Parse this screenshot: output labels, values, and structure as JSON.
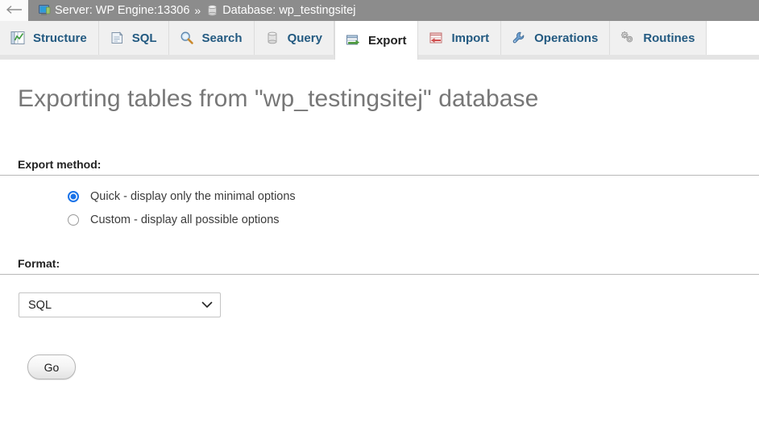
{
  "breadcrumb": {
    "back_label": "back-arrow",
    "separator": "»",
    "items": [
      {
        "icon": "server-monitor-icon",
        "label": "Server: WP Engine:13306"
      },
      {
        "icon": "database-cylinder-icon",
        "label": "Database: wp_testingsitej"
      }
    ]
  },
  "tabs": [
    {
      "id": "structure",
      "label": "Structure",
      "icon": "structure-icon",
      "active": false
    },
    {
      "id": "sql",
      "label": "SQL",
      "icon": "sql-icon",
      "active": false
    },
    {
      "id": "search",
      "label": "Search",
      "icon": "search-icon",
      "active": false
    },
    {
      "id": "query",
      "label": "Query",
      "icon": "query-icon",
      "active": false
    },
    {
      "id": "export",
      "label": "Export",
      "icon": "export-icon",
      "active": true
    },
    {
      "id": "import",
      "label": "Import",
      "icon": "import-icon",
      "active": false
    },
    {
      "id": "operations",
      "label": "Operations",
      "icon": "wrench-icon",
      "active": false
    },
    {
      "id": "routines",
      "label": "Routines",
      "icon": "gears-icon",
      "active": false
    }
  ],
  "main": {
    "page_title": "Exporting tables from \"wp_testingsitej\" database",
    "export_method": {
      "heading": "Export method:",
      "options": [
        {
          "value": "quick",
          "label": "Quick - display only the minimal options",
          "checked": true
        },
        {
          "value": "custom",
          "label": "Custom - display all possible options",
          "checked": false
        }
      ]
    },
    "format": {
      "heading": "Format:",
      "selected": "SQL",
      "options": [
        "SQL"
      ]
    },
    "submit_label": "Go"
  },
  "colors": {
    "breadcrumb_bar": "#8c8c8c",
    "tab_link": "#235a81",
    "tab_active_text": "#222222",
    "title": "#777777",
    "radio_accent": "#1a73e8"
  }
}
